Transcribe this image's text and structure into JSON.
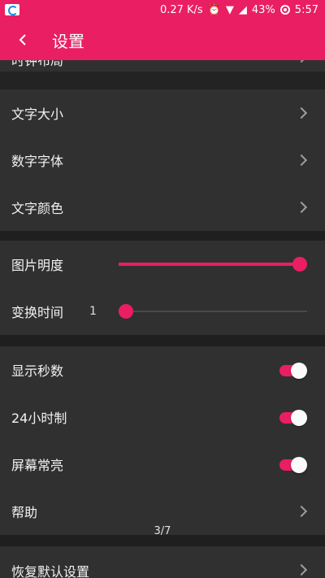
{
  "status_bar": {
    "speed": "0.27 K/s",
    "battery": "43%",
    "time": "5:57",
    "icons": [
      "notification-icon",
      "alarm-icon",
      "wifi-icon",
      "signal-icon",
      "battery-circle-icon"
    ]
  },
  "app_bar": {
    "title": "设置"
  },
  "rows": {
    "clock_layout": "时钟布局",
    "text_size": "文字大小",
    "digit_font": "数字字体",
    "text_color": "文字颜色",
    "image_brightness": "图片明度",
    "switch_time": "变换时间",
    "switch_time_value": "1",
    "show_seconds": "显示秒数",
    "hour24": "24小时制",
    "screen_on": "屏幕常亮",
    "help": "帮助",
    "restore_defaults": "恢复默认设置"
  },
  "page_indicator": "3/7",
  "controls": {
    "image_brightness_fraction": 1.0,
    "switch_time_fraction": 0.0,
    "show_seconds_on": true,
    "hour24_on": true,
    "screen_on_on": true
  },
  "colors": {
    "accent": "#e91e63",
    "background": "#303030"
  }
}
